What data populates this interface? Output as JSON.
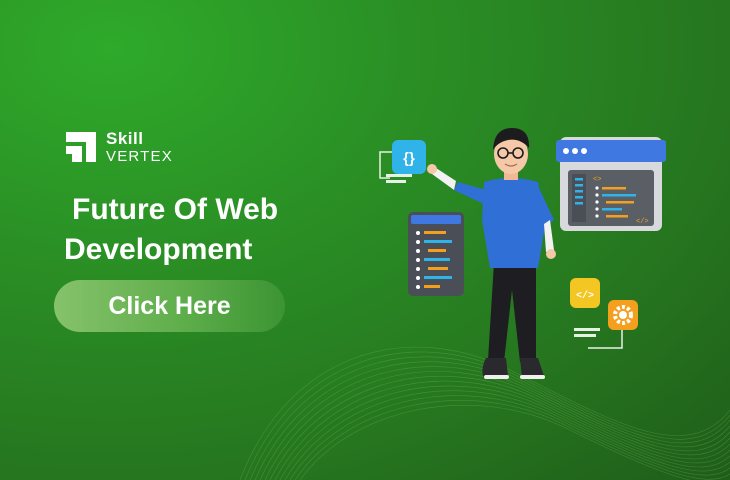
{
  "brand": {
    "line1": "Skill",
    "line2": "VERTEX"
  },
  "headline": {
    "line1": "Future Of Web",
    "line2": "Development"
  },
  "cta": {
    "label": "Click Here"
  },
  "code_tags": {
    "braces": "{}",
    "open_tag": "<>",
    "close_tag": "</>",
    "badge_tag": "</>"
  },
  "colors": {
    "background": "#2a8f25",
    "cta_start": "#86c26a",
    "cta_end": "#3c9432",
    "shirt": "#2f6fd6",
    "window_header": "#3f78e0",
    "icon_yellow": "#f3c623",
    "icon_orange": "#f59f1e",
    "icon_cyan": "#2fb3e8"
  },
  "icons": [
    "skill-vertex-logo-icon",
    "curly-braces-icon",
    "code-tag-icon",
    "gear-icon",
    "code-window-icon"
  ]
}
